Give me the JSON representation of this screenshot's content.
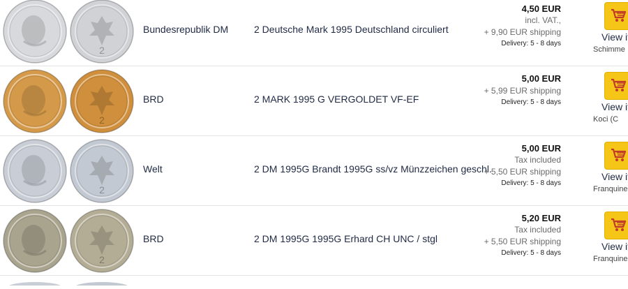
{
  "rows": [
    {
      "country": "Bundesrepublik DM",
      "title": "2 Deutsche Mark 1995 Deutschland circuliert",
      "price": "4,50 EUR",
      "tax": "incl. VAT.,",
      "shipping": "+ 9,90 EUR shipping",
      "delivery": "Delivery: 5 - 8 days",
      "action": "View it",
      "seller": "Schimme",
      "coin_colors": [
        "#d8d9dc",
        "#d0d2d6"
      ]
    },
    {
      "country": "BRD",
      "title": "2 MARK 1995 G VERGOLDET VF-EF",
      "price": "5,00 EUR",
      "tax": "",
      "shipping": "+ 5,99 EUR shipping",
      "delivery": "Delivery: 5 - 8 days",
      "action": "View it",
      "seller": "Koci (C",
      "coin_colors": [
        "#d49a4a",
        "#cf8f3c"
      ]
    },
    {
      "country": "Welt",
      "title": "2 DM 1995G Brandt 1995G ss/vz Münzzeichen geschl.",
      "price": "5,00 EUR",
      "tax": "Tax included",
      "shipping": "+ 5,50 EUR shipping",
      "delivery": "Delivery: 5 - 8 days",
      "action": "View it",
      "seller": "Franquine",
      "coin_colors": [
        "#c9ced6",
        "#c3c9d2"
      ]
    },
    {
      "country": "BRD",
      "title": "2 DM 1995G 1995G Erhard CH UNC / stgl",
      "price": "5,20 EUR",
      "tax": "Tax included",
      "shipping": "+ 5,50 EUR shipping",
      "delivery": "Delivery: 5 - 8 days",
      "action": "View it",
      "seller": "Franquine",
      "coin_colors": [
        "#a9a48e",
        "#b3ad95"
      ]
    }
  ],
  "theme": {
    "cart_bg": "#f5c518",
    "cart_icon": "#c0392b",
    "text": "#1f2a44"
  }
}
